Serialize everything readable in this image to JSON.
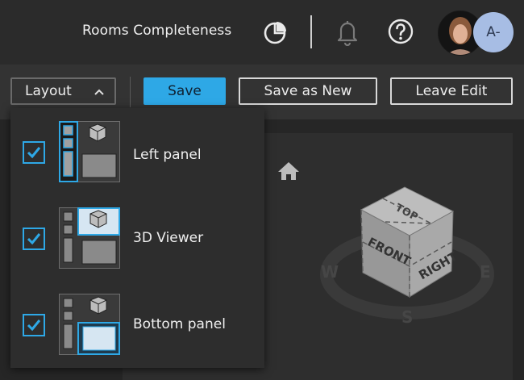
{
  "header": {
    "title": "Rooms Completeness",
    "avatar_initials": "A-"
  },
  "toolbar": {
    "layout_label": "Layout",
    "save_label": "Save",
    "save_as_new_label": "Save as New",
    "leave_edit_label": "Leave Edit"
  },
  "layout_menu": {
    "items": [
      {
        "label": "Left panel",
        "checked": true
      },
      {
        "label": "3D Viewer",
        "checked": true
      },
      {
        "label": "Bottom panel",
        "checked": true
      }
    ]
  },
  "viewcube": {
    "faces": [
      "TOP",
      "FRONT",
      "RIGHT"
    ],
    "compass": [
      "W",
      "E",
      "S"
    ]
  },
  "colors": {
    "accent": "#2ea8e6",
    "avatar_bg": "#a7bde4"
  },
  "icons": [
    "pie-chart-icon",
    "bell-icon",
    "help-icon",
    "chevron-up-icon",
    "check-icon",
    "home-icon"
  ]
}
